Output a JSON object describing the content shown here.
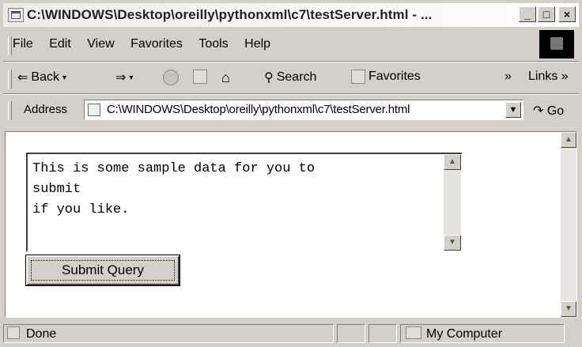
{
  "window": {
    "title": "C:\\WINDOWS\\Desktop\\oreilly\\pythonxml\\c7\\testServer.html - ...",
    "controls": {
      "minimize": "_",
      "maximize": "□",
      "close": "×"
    }
  },
  "menu": {
    "items": [
      {
        "label": "File"
      },
      {
        "label": "Edit"
      },
      {
        "label": "View"
      },
      {
        "label": "Favorites"
      },
      {
        "label": "Tools"
      },
      {
        "label": "Help"
      }
    ]
  },
  "toolbar": {
    "back": "Back",
    "search": "Search",
    "favorites": "Favorites",
    "more": "»",
    "links": "Links »"
  },
  "address": {
    "label": "Address",
    "value": "C:\\WINDOWS\\Desktop\\oreilly\\pythonxml\\c7\\testServer.html",
    "go": "Go"
  },
  "form": {
    "textarea_value": "This is some sample data for you to\nsubmit\nif you like.",
    "submit_label": "Submit Query"
  },
  "status": {
    "text": "Done",
    "zone": "My Computer"
  }
}
